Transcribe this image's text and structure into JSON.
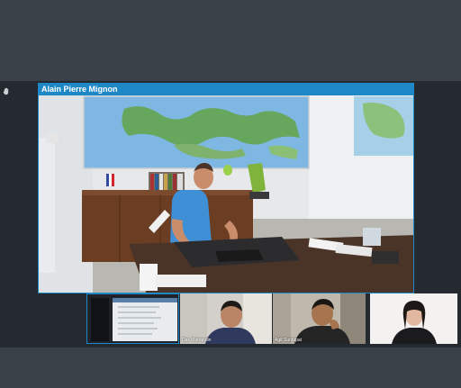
{
  "active_speaker": {
    "name": "Alain Pierre Mignon"
  },
  "participants": [
    {
      "name": ""
    },
    {
      "name": "Dac Martandin"
    },
    {
      "name": "Agit Suntapat"
    },
    {
      "name": ""
    }
  ],
  "icons": {
    "side": "hand-icon"
  },
  "colors": {
    "accent": "#1e88c7",
    "background": "#3a4047",
    "stage": "#252a30"
  }
}
